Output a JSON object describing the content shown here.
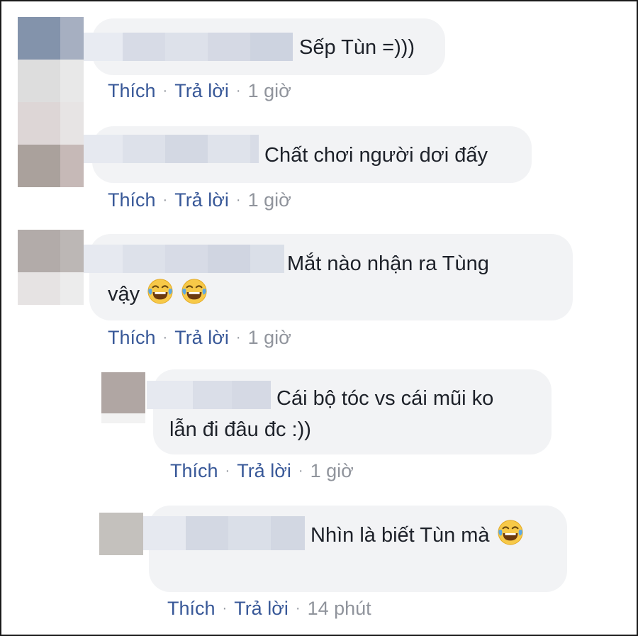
{
  "comments": [
    {
      "text_lines": [
        "Sếp Tùn =)))"
      ],
      "emoji_count": 0,
      "actions": {
        "like": "Thích",
        "reply": "Trả lời",
        "time": "1 giờ"
      }
    },
    {
      "text_lines": [
        "Chất chơi người dơi đấy"
      ],
      "emoji_count": 0,
      "actions": {
        "like": "Thích",
        "reply": "Trả lời",
        "time": "1 giờ"
      }
    },
    {
      "text_lines": [
        "Mắt nào nhận ra Tùng",
        "vậy"
      ],
      "emoji_count": 2,
      "emoji": "laughing-tears",
      "actions": {
        "like": "Thích",
        "reply": "Trả lời",
        "time": "1 giờ"
      }
    },
    {
      "text_lines": [
        "Cái bộ tóc vs cái mũi ko",
        "lẫn đi đâu đc :))"
      ],
      "emoji_count": 0,
      "actions": {
        "like": "Thích",
        "reply": "Trả lời",
        "time": "1 giờ"
      }
    },
    {
      "text_lines": [
        "Nhìn là biết Tùn mà"
      ],
      "emoji_count": 1,
      "emoji": "laughing-tears",
      "actions": {
        "like": "Thích",
        "reply": "Trả lời",
        "time": "14 phút"
      }
    }
  ],
  "separator": "·",
  "colors": {
    "link": "#385898",
    "meta": "#90949c",
    "bubble": "#f2f3f5",
    "text": "#1d2129"
  }
}
